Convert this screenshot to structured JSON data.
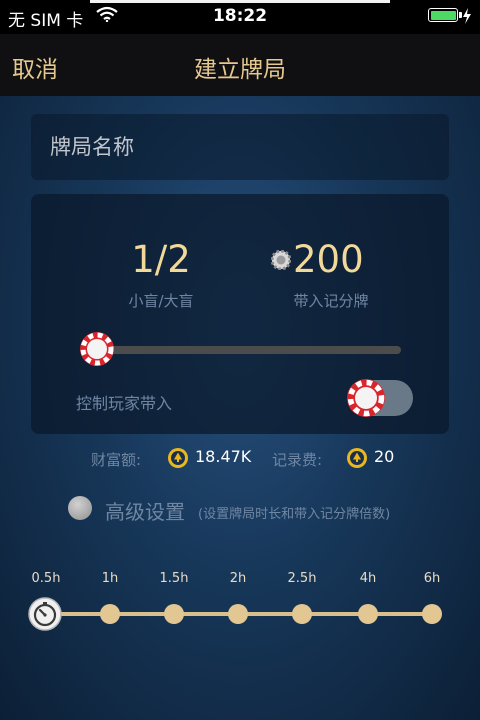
{
  "status_bar": {
    "carrier": "无 SIM 卡",
    "time": "18:22",
    "battery_color": "#4cd964"
  },
  "nav": {
    "cancel": "取消",
    "title": "建立牌局"
  },
  "table_name": {
    "placeholder": "牌局名称"
  },
  "settings": {
    "blinds_value": "1/2",
    "blinds_label": "小盲/大盲",
    "buyin_value": "200",
    "buyin_label": "带入记分牌",
    "blind_slider_level": 0,
    "control_buyin_label": "控制玩家带入",
    "control_buyin_on": false
  },
  "fees": {
    "wealth_label": "财富额:",
    "wealth_value": "18.47K",
    "fee_label": "记录费:",
    "fee_value": "20"
  },
  "advanced": {
    "label": "高级设置",
    "note": "(设置牌局时长和带入记分牌倍数)"
  },
  "duration": {
    "options": [
      "0.5h",
      "1h",
      "1.5h",
      "2h",
      "2.5h",
      "4h",
      "6h"
    ],
    "selected_index": 0
  },
  "colors": {
    "accent_gold": "#e6c98e",
    "value_gold": "#f2d99a",
    "muted_label": "#6f86a3",
    "chip_red": "#d9262d"
  }
}
